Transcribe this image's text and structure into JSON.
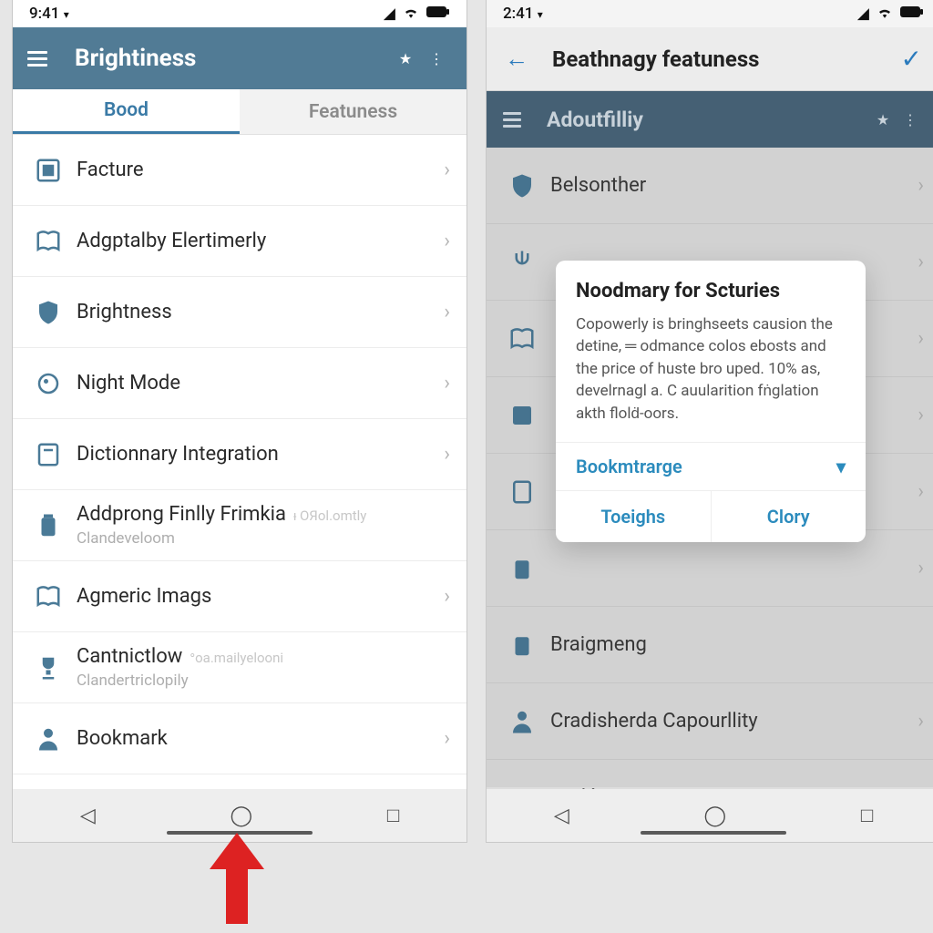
{
  "left": {
    "status": {
      "time": "9:41",
      "tri": "▾"
    },
    "appbar": {
      "title": "Brightiness"
    },
    "tabs": [
      {
        "label": "Bood",
        "active": true
      },
      {
        "label": "Featuness",
        "active": false
      }
    ],
    "rows": [
      {
        "icon": "grid-icon",
        "label": "Facture"
      },
      {
        "icon": "book-icon",
        "label": "Adgptalby Elertimerly"
      },
      {
        "icon": "shield-icon",
        "label": "Brightness"
      },
      {
        "icon": "moon-icon",
        "label": "Night Mode"
      },
      {
        "icon": "dict-icon",
        "label": "Dictionnary Integration"
      },
      {
        "icon": "jar-icon",
        "label": "Addprong Finlly Frimkia",
        "faded": "ᵻ OЯol.omtly",
        "sub": "Clandeveloom",
        "nochev": true
      },
      {
        "icon": "book-icon",
        "label": "Agmeric Imags"
      },
      {
        "icon": "trophy-icon",
        "label": "Cantnictlow",
        "faded": "ᐤoa.mailyelooni",
        "sub": "Clandertriclopily",
        "nochev": true
      },
      {
        "icon": "person-icon",
        "label": "Bookmark"
      }
    ]
  },
  "right": {
    "status": {
      "time": "2:41",
      "tri": "▾"
    },
    "appbar2": {
      "title": "Beathnagy featuness"
    },
    "appbarR": {
      "title": "Adoutfilliy"
    },
    "rows": [
      {
        "icon": "shield-icon",
        "label": "Belsonther"
      },
      {
        "icon": "fork-icon",
        "label": ""
      },
      {
        "icon": "book-icon",
        "label": ""
      },
      {
        "icon": "tile-icon",
        "label": ""
      },
      {
        "icon": "doc-icon",
        "label": ""
      },
      {
        "icon": "jar-icon",
        "label": ""
      },
      {
        "icon": "jar-icon",
        "label": "Braigmeng",
        "nochev": true
      },
      {
        "icon": "person-icon",
        "label": "Cradisherda Capourllity"
      },
      {
        "icon": "train-icon",
        "label": "Borlńin Anenta"
      }
    ],
    "dialog": {
      "title": "Noodmary for Scturies",
      "body": "Copowerly is bringhseets causion the detine, ═ odmance colos ebosts and the price of huste bro uped. 10% as, develrnagl a. C auularition fṅglation akth flolḋ-oors.",
      "select": "Bookmtrarge",
      "actions": [
        "Toeighs",
        "Clory"
      ]
    }
  },
  "icons": {
    "star": "★",
    "more": "⋮",
    "check": "✓",
    "chev": "›",
    "caret": "▾",
    "back": "←",
    "navback": "◁",
    "navhome": "◯",
    "navrecent": "□",
    "signal": "▮▮▯",
    "wifi": "ᯤ",
    "battery": "▮▮▮"
  }
}
